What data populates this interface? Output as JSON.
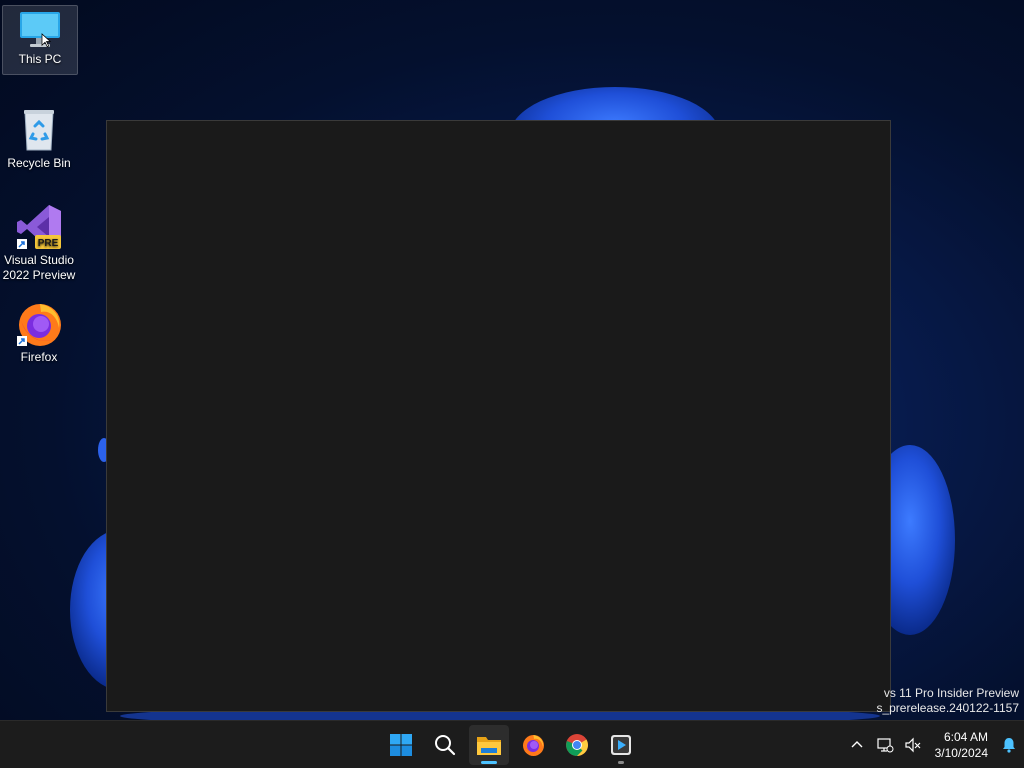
{
  "desktop": {
    "icons": [
      {
        "label": "This PC"
      },
      {
        "label": "Recycle Bin"
      },
      {
        "label": "Visual Studio 2022 Preview",
        "badge": "PRE"
      },
      {
        "label": "Firefox"
      }
    ]
  },
  "watermark": {
    "line1": "vs 11 Pro Insider Preview",
    "line2": "s_prerelease.240122-1157"
  },
  "taskbar": {
    "apps": [
      {
        "icon": "windows-start-icon"
      },
      {
        "icon": "search-icon"
      },
      {
        "icon": "file-explorer-icon"
      },
      {
        "icon": "firefox-icon"
      },
      {
        "icon": "chrome-icon"
      },
      {
        "icon": "media-player-icon"
      }
    ],
    "active_app": "file-explorer-icon",
    "clock": {
      "time": "6:04 AM",
      "date": "3/10/2024"
    }
  },
  "colors": {
    "accent": "#4cc2ff",
    "window_bg": "#1a1a1a",
    "taskbar_bg": "#1c1c1c"
  }
}
